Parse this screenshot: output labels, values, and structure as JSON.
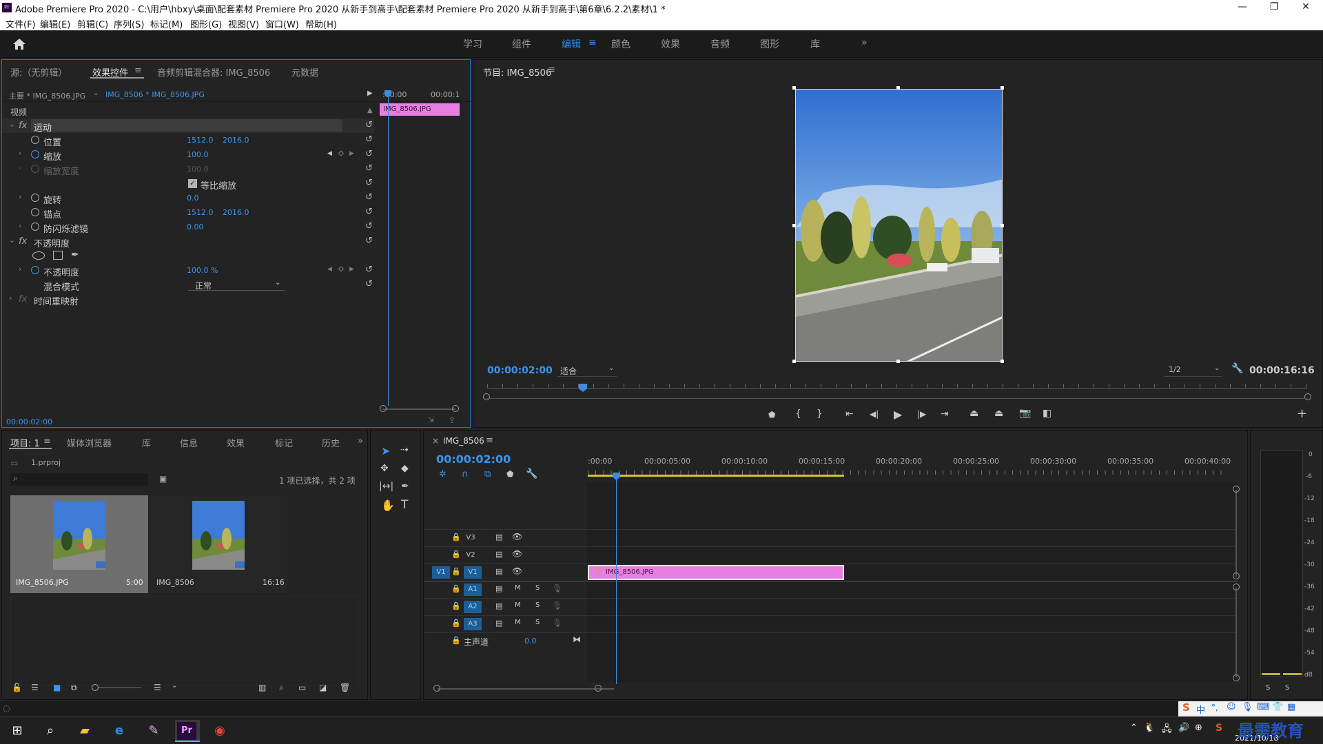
{
  "window": {
    "title": "Adobe Premiere Pro 2020 - C:\\用户\\hbxy\\桌面\\配套素材 Premiere Pro 2020 从新手到高手\\配套素材 Premiere Pro 2020 从新手到高手\\第6章\\6.2.2\\素材\\1 *",
    "logo": "Pr",
    "min_icon": "—",
    "max_icon": "❐",
    "close_icon": "✕"
  },
  "menu": [
    "文件(F)",
    "编辑(E)",
    "剪辑(C)",
    "序列(S)",
    "标记(M)",
    "图形(G)",
    "视图(V)",
    "窗口(W)",
    "帮助(H)"
  ],
  "workspaces": {
    "items": [
      "学习",
      "组件",
      "编辑",
      "颜色",
      "效果",
      "音频",
      "图形",
      "库"
    ],
    "active_index": 2,
    "more": "»",
    "menu_icon": "≡"
  },
  "effect_controls": {
    "tabs": [
      "源:（无剪辑）",
      "效果控件",
      "音频剪辑混合器: IMG_8506",
      "元数据"
    ],
    "tab_menu": "≡",
    "master_label": "主要 * IMG_8506.JPG",
    "sequence_clip": "IMG_8506 * IMG_8506.JPG",
    "mini_time_start": ":00:00",
    "mini_time_end": "00:00:1",
    "clip_name": "IMG_8506.JPG",
    "video_label": "视频",
    "motion": {
      "fx": "fx",
      "name": "运动",
      "position": {
        "label": "位置",
        "x": "1512.0",
        "y": "2016.0"
      },
      "scale": {
        "label": "缩放",
        "value": "100.0"
      },
      "scale_width": {
        "label": "缩放宽度",
        "value": "100.0"
      },
      "uniform_scale": {
        "label": "等比缩放",
        "checked": true
      },
      "rotation": {
        "label": "旋转",
        "value": "0.0"
      },
      "anchor": {
        "label": "锚点",
        "x": "1512.0",
        "y": "2016.0"
      },
      "anti_flicker": {
        "label": "防闪烁滤镜",
        "value": "0.00"
      }
    },
    "opacity": {
      "fx": "fx",
      "name": "不透明度",
      "opacity": {
        "label": "不透明度",
        "value": "100.0 %"
      },
      "blend_mode": {
        "label": "混合模式",
        "value": "正常"
      }
    },
    "time_remap": {
      "fx": "fx",
      "name": "时间重映射"
    },
    "timecode": "00:00:02:00"
  },
  "program_monitor": {
    "title": "节目: IMG_8506",
    "menu_icon": "≡",
    "timecode": "00:00:02:00",
    "fit": "适合",
    "resolution": "1/2",
    "duration": "00:00:16:16",
    "add_icon": "+"
  },
  "project": {
    "tabs": [
      "项目: 1",
      "媒体浏览器",
      "库",
      "信息",
      "效果",
      "标记",
      "历史"
    ],
    "tab_menu": "≡",
    "more": "»",
    "file": "1.prproj",
    "selection": "1 项已选择，共 2 项",
    "items": [
      {
        "name": "IMG_8506.JPG",
        "duration": "5:00",
        "selected": true
      },
      {
        "name": "IMG_8506",
        "duration": "16:16",
        "selected": false
      }
    ]
  },
  "timeline": {
    "close": "×",
    "sequence": "IMG_8506",
    "menu_icon": "≡",
    "timecode": "00:00:02:00",
    "ruler": [
      ":00:00",
      "00:00:05:00",
      "00:00:10:00",
      "00:00:15:00",
      "00:00:20:00",
      "00:00:25:00",
      "00:00:30:00",
      "00:00:35:00",
      "00:00:40:00"
    ],
    "video_tracks": [
      "V3",
      "V2",
      "V1"
    ],
    "audio_tracks": [
      "A1",
      "A2",
      "A3"
    ],
    "source_patch": "V1",
    "master": {
      "label": "主声道",
      "value": "0.0"
    },
    "clip": {
      "name": "IMG_8506.JPG",
      "fx": "fx"
    },
    "mute": "M",
    "solo": "S"
  },
  "audio_meter": {
    "scale": [
      "0",
      "-6",
      "-12",
      "-18",
      "-24",
      "-30",
      "-36",
      "-42",
      "-48",
      "-54",
      "dB"
    ],
    "solo": [
      "S",
      "S"
    ]
  },
  "taskbar": {
    "date": "2021/10/18",
    "watermark": "最需教育",
    "ime": "中",
    "icons": [
      "windows-icon",
      "search-icon",
      "file-explorer-icon",
      "edge-icon",
      "paint-icon",
      "premiere-icon",
      "chrome-icon"
    ]
  },
  "colors": {
    "accent": "#2d8ceb",
    "clip": "#e77fe0",
    "panel": "#232323"
  }
}
